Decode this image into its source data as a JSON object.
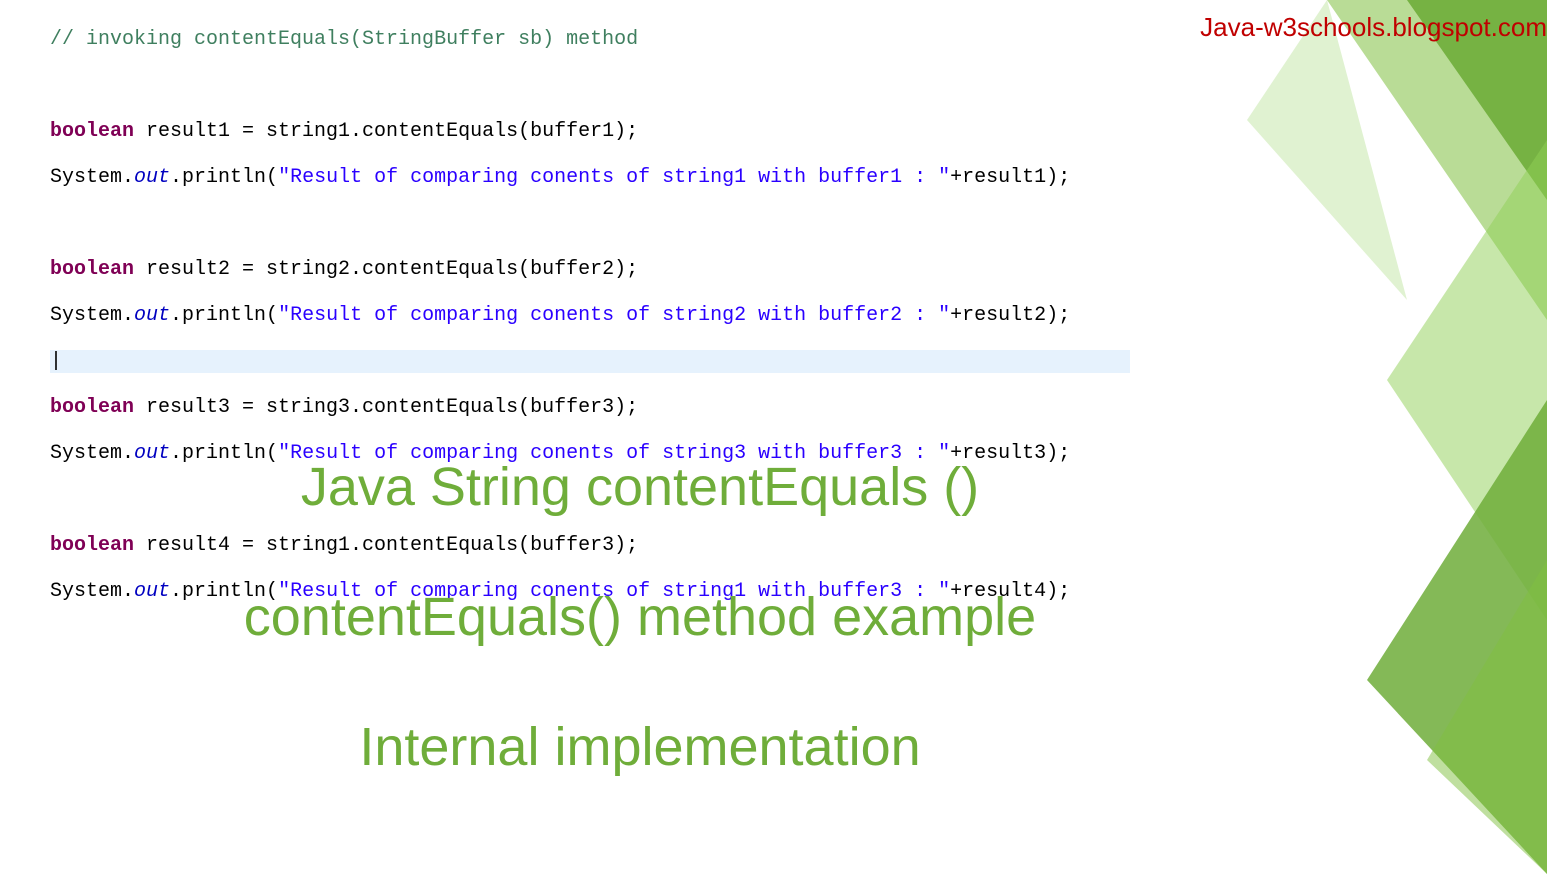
{
  "watermark": "Java-w3schools.blogspot.com",
  "code": {
    "comment": "// invoking contentEquals(StringBuffer sb) method",
    "blocks": [
      {
        "decl_kw": "boolean",
        "decl_rest": " result1 = string1.contentEquals(buffer1);",
        "print_pre": "System.",
        "print_out": "out",
        "print_mid": ".println(",
        "print_str": "\"Result of comparing conents of string1 with buffer1 : \"",
        "print_post": "+result1);"
      },
      {
        "decl_kw": "boolean",
        "decl_rest": " result2 = string2.contentEquals(buffer2);",
        "print_pre": "System.",
        "print_out": "out",
        "print_mid": ".println(",
        "print_str": "\"Result of comparing conents of string2 with buffer2 : \"",
        "print_post": "+result2);"
      },
      {
        "decl_kw": "boolean",
        "decl_rest": " result3 = string3.contentEquals(buffer3);",
        "print_pre": "System.",
        "print_out": "out",
        "print_mid": ".println(",
        "print_str": "\"Result of comparing conents of string3 with buffer3 : \"",
        "print_post": "+result3);"
      },
      {
        "decl_kw": "boolean",
        "decl_rest": " result4 = string1.contentEquals(buffer3);",
        "print_pre": "System.",
        "print_out": "out",
        "print_mid": ".println(",
        "print_str": "\"Result of comparing conents of string1 with buffer3 : \"",
        "print_post": "+result4);"
      }
    ]
  },
  "titles": {
    "line1": "Java String contentEquals ()",
    "line2": "contentEquals() method example",
    "line3": "Internal implementation"
  }
}
